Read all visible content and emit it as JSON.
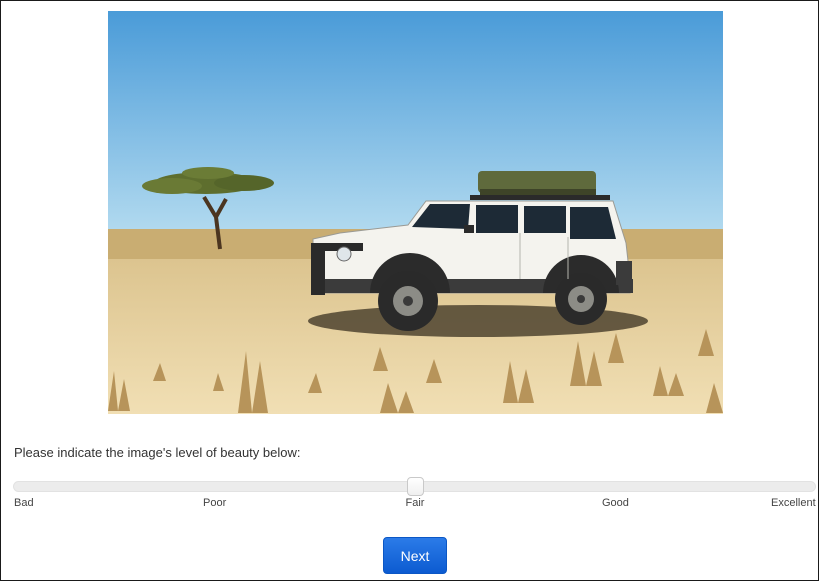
{
  "prompt": "Please indicate the image's level of beauty below:",
  "slider": {
    "labels": [
      "Bad",
      "Poor",
      "Fair",
      "Good",
      "Excellent"
    ],
    "value_fraction": 0.5
  },
  "next_button": {
    "label": "Next",
    "color": "#1665d8"
  },
  "photo": {
    "subject": "white-suv-in-desert-photo"
  }
}
